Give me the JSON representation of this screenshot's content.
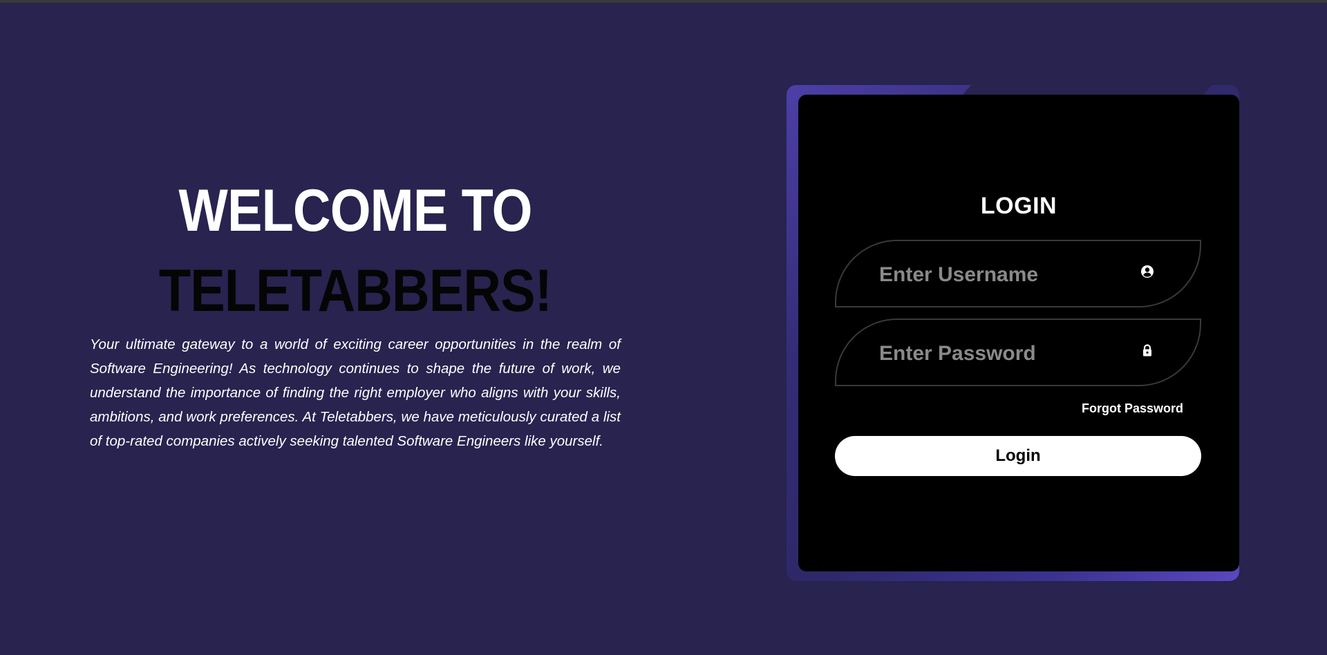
{
  "hero": {
    "line1": "WELCOME TO",
    "line2": "TELETABBERS!",
    "description": "Your ultimate gateway to a world of exciting career opportunities in the realm of Software Engineering! As technology continues to shape the future of work, we understand the importance of finding the right employer who aligns with your skills, ambitions, and work preferences. At Teletabbers, we have meticulously curated a list of top-rated companies actively seeking talented Software Engineers like yourself."
  },
  "login": {
    "title": "LOGIN",
    "username": {
      "placeholder": "Enter Username",
      "value": "",
      "icon": "user-circle-icon"
    },
    "password": {
      "placeholder": "Enter Password",
      "value": "",
      "icon": "lock-icon"
    },
    "forgot_label": "Forgot Password",
    "button_label": "Login"
  },
  "colors": {
    "background": "#28234f",
    "card": "#000000",
    "accent": "#5a48c0",
    "field_border": "#3a3a3a",
    "button": "#ffffff"
  }
}
